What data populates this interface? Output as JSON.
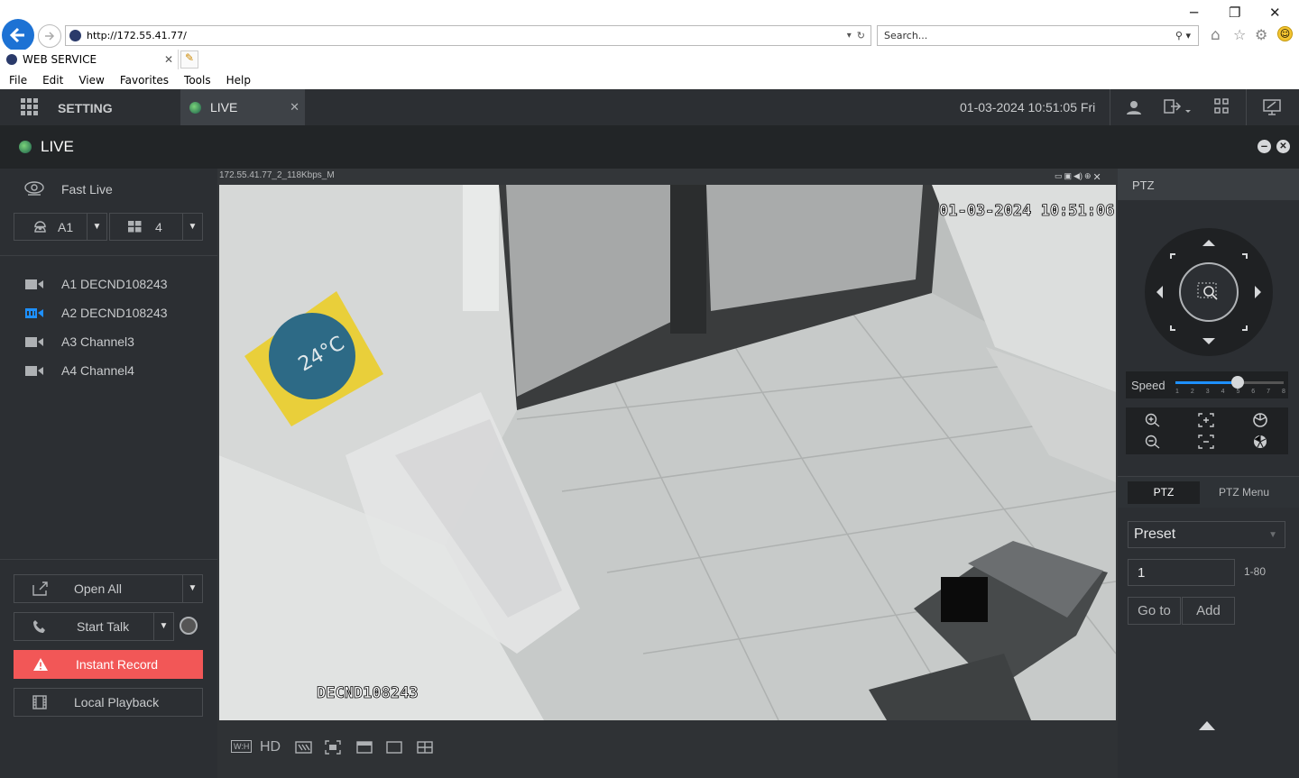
{
  "browser": {
    "url": "http://172.55.41.77/",
    "search_placeholder": "Search...",
    "tab_title": "WEB SERVICE",
    "menu": [
      "File",
      "Edit",
      "View",
      "Favorites",
      "Tools",
      "Help"
    ]
  },
  "header": {
    "setting_label": "SETTING",
    "live_tab_label": "LIVE",
    "datetime": "01-03-2024 10:51:05 Fri"
  },
  "live_bar": {
    "title": "LIVE"
  },
  "left_panel": {
    "fast_live": "Fast Live",
    "stream_select": "A1",
    "layout_select": "4",
    "channels": [
      {
        "label": "A1 DECND108243",
        "active": false
      },
      {
        "label": "A2 DECND108243",
        "active": true
      },
      {
        "label": "A3 Channel3",
        "active": false
      },
      {
        "label": "A4 Channel4",
        "active": false
      }
    ],
    "open_all": "Open All",
    "start_talk": "Start Talk",
    "instant_record": "Instant Record",
    "local_playback": "Local Playback"
  },
  "video": {
    "stream_label": "172.55.41.77_2_118Kbps_M",
    "osd_datetime": "01-03-2024 10:51:06",
    "osd_name": "DECND108243",
    "sticker_text": "24°C",
    "hd_label": "HD",
    "wh_label": "W:H"
  },
  "ptz": {
    "title": "PTZ",
    "speed_label": "Speed",
    "speed_ticks": [
      "1",
      "2",
      "3",
      "4",
      "5",
      "6",
      "7",
      "8"
    ],
    "speed_value": 5,
    "tab_ptz": "PTZ",
    "tab_menu": "PTZ Menu",
    "preset_select": "Preset",
    "preset_value": "1",
    "preset_range": "1-80",
    "goto_label": "Go to",
    "add_label": "Add"
  },
  "colors": {
    "accent": "#1e90ff",
    "record": "#f25757",
    "header_bg": "#2c2f33"
  }
}
